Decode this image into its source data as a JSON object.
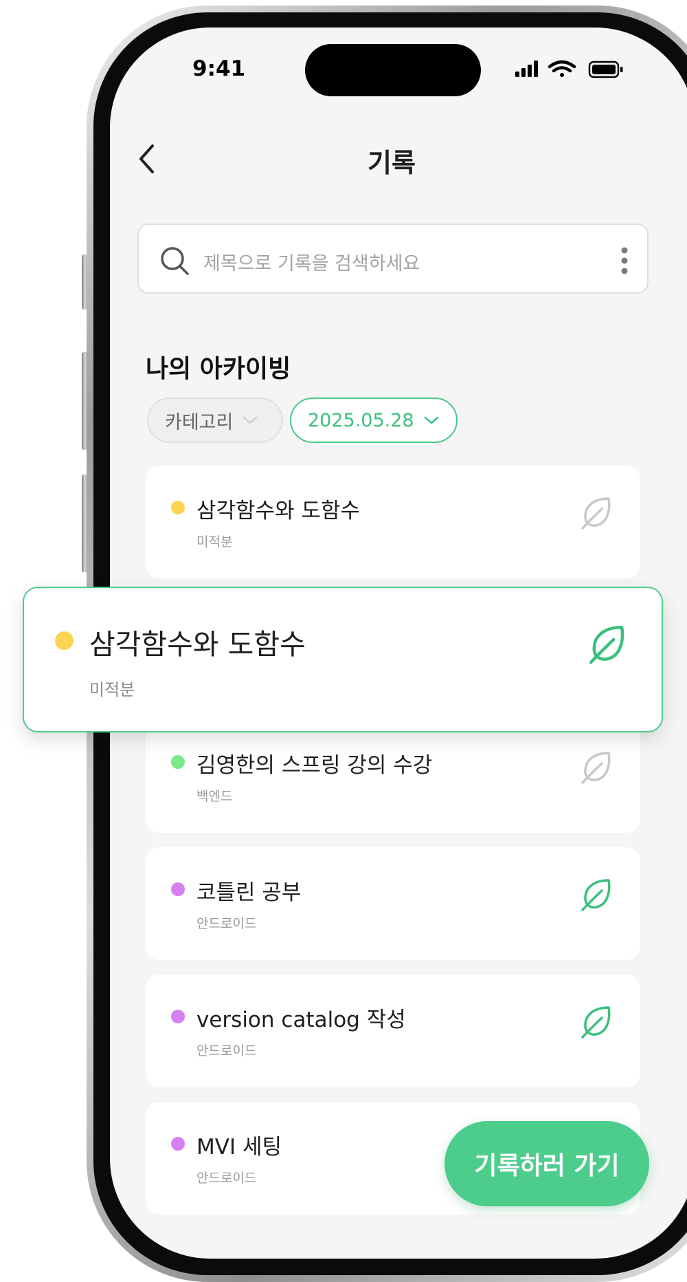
{
  "status_bar": {
    "time": "9:41"
  },
  "header": {
    "title": "기록"
  },
  "search": {
    "placeholder": "제목으로 기록을 검색하세요"
  },
  "section": {
    "title": "나의 아카이빙"
  },
  "filters": {
    "category_label": "카테고리",
    "date_label": "2025.05.28"
  },
  "colors": {
    "accent": "#4ccd8c",
    "yellow": "#fcd451",
    "green": "#7be88a",
    "purple": "#d680f0",
    "leaf_inactive": "#c8c8c8"
  },
  "records": [
    {
      "title": "삼각함수와 도함수",
      "category": "미적분",
      "dot_color": "#fcd451",
      "leaf_active": false
    },
    {
      "title": "김영한의 스프링 강의 수강",
      "category": "백엔드",
      "dot_color": "#7be88a",
      "leaf_active": false
    },
    {
      "title": "코틀린 공부",
      "category": "안드로이드",
      "dot_color": "#d680f0",
      "leaf_active": true
    },
    {
      "title": "version catalog 작성",
      "category": "안드로이드",
      "dot_color": "#d680f0",
      "leaf_active": true
    },
    {
      "title": "MVI 세팅",
      "category": "안드로이드",
      "dot_color": "#d680f0",
      "leaf_active": false
    }
  ],
  "dragged_record": {
    "title": "삼각함수와 도함수",
    "category": "미적분",
    "dot_color": "#fcd451",
    "leaf_active": true
  },
  "fab": {
    "label": "기록하러 가기"
  },
  "icons": [
    "back-icon",
    "search-icon",
    "more-icon",
    "chevron-down-icon",
    "leaf-icon",
    "signal-icon",
    "wifi-icon",
    "battery-icon"
  ]
}
